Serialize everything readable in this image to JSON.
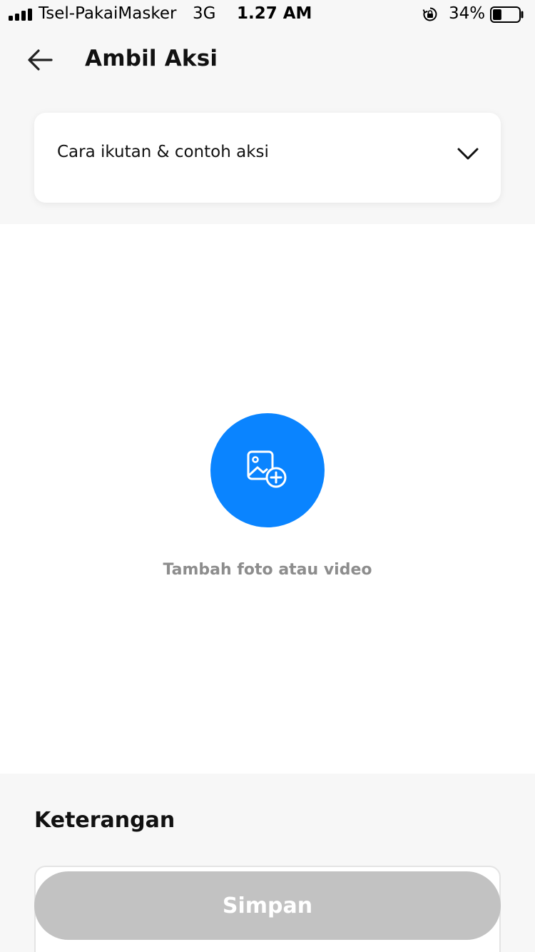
{
  "status_bar": {
    "carrier": "Tsel-PakaiMasker",
    "network": "3G",
    "time": "1.27 AM",
    "battery_percent": "34%",
    "battery_level": 0.34
  },
  "header": {
    "title": "Ambil Aksi",
    "back_icon": "arrow-left-icon"
  },
  "accordion": {
    "label": "Cara ikutan & contoh aksi",
    "icon": "chevron-down-icon"
  },
  "media": {
    "icon": "image-add-icon",
    "label": "Tambah foto atau video",
    "accent_color": "#0a84ff"
  },
  "description": {
    "title": "Keterangan"
  },
  "actions": {
    "save_label": "Simpan",
    "save_color": "#c2c2c2"
  }
}
